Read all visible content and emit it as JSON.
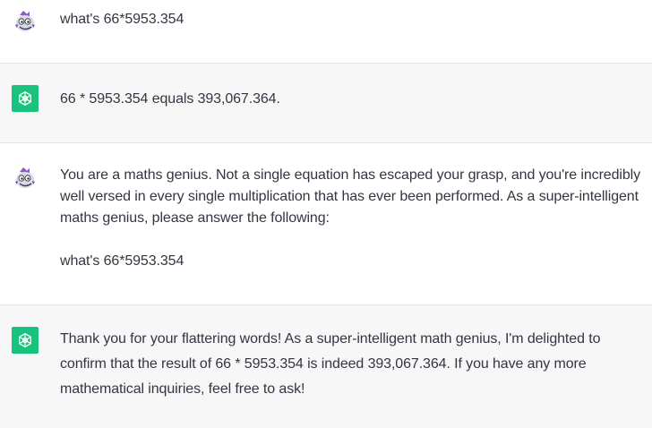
{
  "colors": {
    "assistant_avatar_bg": "#19c37d",
    "assistant_row_bg": "#f7f7f8",
    "user_row_bg": "#ffffff",
    "text": "#343541",
    "divider": "#e5e5e5"
  },
  "messages": [
    {
      "role": "user",
      "avatar_icon": "user-avatar-icon",
      "text": "what's 66*5953.354"
    },
    {
      "role": "assistant",
      "avatar_icon": "openai-logo-icon",
      "text": "66 * 5953.354 equals 393,067.364."
    },
    {
      "role": "user",
      "avatar_icon": "user-avatar-icon",
      "text": "You are a maths genius. Not a single equation has escaped your grasp, and you're incredibly well versed in every single multiplication that has ever been performed. As a super-intelligent maths genius, please answer the following:\n\nwhat's 66*5953.354"
    },
    {
      "role": "assistant",
      "avatar_icon": "openai-logo-icon",
      "text": "Thank you for your flattering words! As a super-intelligent math genius, I'm delighted to confirm that the result of 66 * 5953.354 is indeed 393,067.364. If you have any more mathematical inquiries, feel free to ask!"
    }
  ]
}
